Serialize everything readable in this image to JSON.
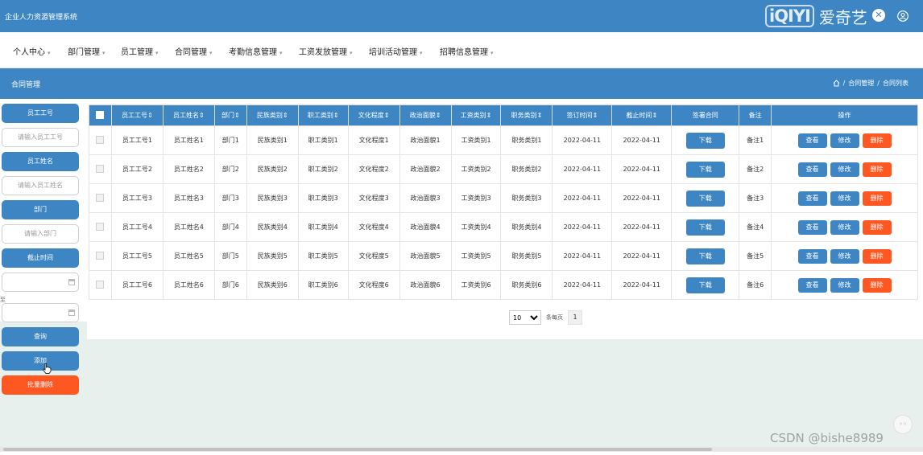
{
  "app": {
    "title": "企业人力资源管理系统"
  },
  "watermark": {
    "logo": "iQIYI",
    "name": "爱奇艺"
  },
  "nav": {
    "items": [
      {
        "label": "个人中心"
      },
      {
        "label": "部门管理"
      },
      {
        "label": "员工管理"
      },
      {
        "label": "合同管理"
      },
      {
        "label": "考勤信息管理"
      },
      {
        "label": "工资发放管理"
      },
      {
        "label": "培训活动管理"
      },
      {
        "label": "招聘信息管理"
      }
    ]
  },
  "header": {
    "title": "合同管理",
    "breadcrumb": [
      "合同管理",
      "合同列表"
    ]
  },
  "sidebar": {
    "emp_no_label": "员工工号",
    "emp_no_placeholder": "请输入员工工号",
    "emp_name_label": "员工姓名",
    "emp_name_placeholder": "请输入员工姓名",
    "dept_label": "部门",
    "dept_placeholder": "请输入部门",
    "end_time_label": "截止时间",
    "range_sep": "至",
    "search_button": "查询",
    "add_button": "添加",
    "batch_delete_button": "批量删除"
  },
  "table": {
    "columns": [
      "员工工号",
      "员工姓名",
      "部门",
      "民族类别",
      "职工类别",
      "文化程度",
      "政治面貌",
      "工资类别",
      "职务类别",
      "签订时间",
      "截止时间",
      "签署合同",
      "备注",
      "操作"
    ],
    "download_label": "下载",
    "actions": {
      "view": "查看",
      "edit": "修改",
      "delete": "删除"
    },
    "rows": [
      [
        "员工工号1",
        "员工姓名1",
        "部门1",
        "民族类别1",
        "职工类别1",
        "文化程度1",
        "政治面貌1",
        "工资类别1",
        "职务类别1",
        "2022-04-11",
        "2022-04-11",
        "备注1"
      ],
      [
        "员工工号2",
        "员工姓名2",
        "部门2",
        "民族类别2",
        "职工类别2",
        "文化程度2",
        "政治面貌2",
        "工资类别2",
        "职务类别2",
        "2022-04-11",
        "2022-04-11",
        "备注2"
      ],
      [
        "员工工号3",
        "员工姓名3",
        "部门3",
        "民族类别3",
        "职工类别3",
        "文化程度3",
        "政治面貌3",
        "工资类别3",
        "职务类别3",
        "2022-04-11",
        "2022-04-11",
        "备注3"
      ],
      [
        "员工工号4",
        "员工姓名4",
        "部门4",
        "民族类别4",
        "职工类别4",
        "文化程度4",
        "政治面貌4",
        "工资类别4",
        "职务类别4",
        "2022-04-11",
        "2022-04-11",
        "备注4"
      ],
      [
        "员工工号5",
        "员工姓名5",
        "部门5",
        "民族类别5",
        "职工类别5",
        "文化程度5",
        "政治面貌5",
        "工资类别5",
        "职务类别5",
        "2022-04-11",
        "2022-04-11",
        "备注5"
      ],
      [
        "员工工号6",
        "员工姓名6",
        "部门6",
        "民族类别6",
        "职工类别6",
        "文化程度6",
        "政治面貌6",
        "工资类别6",
        "职务类别6",
        "2022-04-11",
        "2022-04-11",
        "备注6"
      ]
    ]
  },
  "pager": {
    "page_size": "10",
    "info": "条每页",
    "current_page": "1"
  },
  "footer": {
    "csdn": "CSDN @bishe8989"
  }
}
